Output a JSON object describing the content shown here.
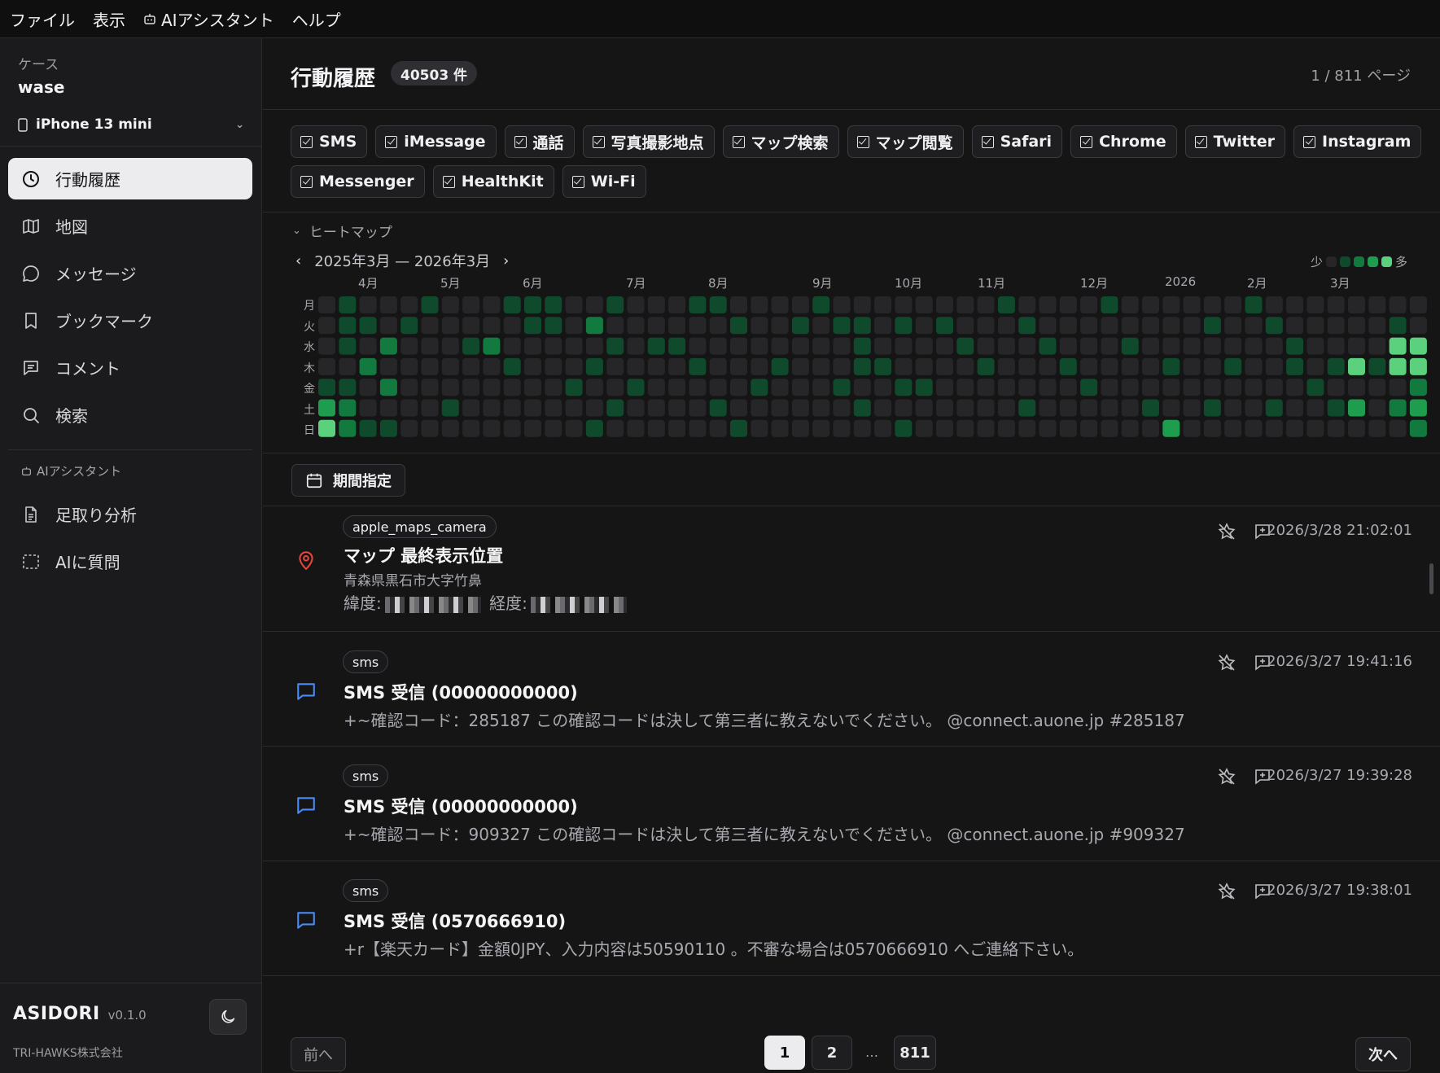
{
  "menu": [
    "ファイル",
    "表示",
    "AIアシスタント",
    "ヘルプ"
  ],
  "sidebar": {
    "case_label": "ケース",
    "case_name": "wase",
    "device": "iPhone 13 mini",
    "items": [
      {
        "label": "行動履歴",
        "icon": "clock-icon",
        "active": true
      },
      {
        "label": "地図",
        "icon": "map-icon"
      },
      {
        "label": "メッセージ",
        "icon": "message-icon"
      },
      {
        "label": "ブックマーク",
        "icon": "bookmark-icon"
      },
      {
        "label": "コメント",
        "icon": "comment-icon"
      },
      {
        "label": "検索",
        "icon": "search-icon"
      }
    ],
    "ai_header": "AIアシスタント",
    "ai_items": [
      {
        "label": "足取り分析",
        "icon": "document-icon"
      },
      {
        "label": "AIに質問",
        "icon": "dashed-square-icon"
      }
    ],
    "app_name": "ASIDORI",
    "version": "v0.1.0",
    "company": "TRI-HAWKS株式会社"
  },
  "header": {
    "title": "行動履歴",
    "count": "40503 件",
    "page_info": "1 / 811 ページ"
  },
  "filters": [
    "SMS",
    "iMessage",
    "通話",
    "写真撮影地点",
    "マップ検索",
    "マップ閲覧",
    "Safari",
    "Chrome",
    "Twitter",
    "Instagram",
    "Messenger",
    "HealthKit",
    "Wi-Fi"
  ],
  "heatmap": {
    "toggle_label": "ヒートマップ",
    "range": "2025年3月 — 2026年3月",
    "legend_less": "少",
    "legend_more": "多",
    "months": [
      "4月",
      "5月",
      "6月",
      "7月",
      "8月",
      "9月",
      "10月",
      "11月",
      "12月",
      "2026",
      "2月",
      "3月"
    ],
    "days": [
      "月",
      "火",
      "水",
      "木",
      "金",
      "土",
      "日"
    ],
    "colors": [
      "#262628",
      "#0f4a2c",
      "#137a3f",
      "#1f9d4f",
      "#5bd17d"
    ],
    "weeks": 53,
    "cells": [
      [
        4,
        0,
        1
      ],
      [
        5,
        0,
        3
      ],
      [
        6,
        0,
        4
      ],
      [
        0,
        1,
        1
      ],
      [
        1,
        1,
        1
      ],
      [
        2,
        1,
        1
      ],
      [
        4,
        1,
        1
      ],
      [
        5,
        1,
        2
      ],
      [
        6,
        1,
        2
      ],
      [
        1,
        2,
        1
      ],
      [
        3,
        2,
        2
      ],
      [
        6,
        2,
        1
      ],
      [
        2,
        3,
        2
      ],
      [
        4,
        3,
        2
      ],
      [
        6,
        3,
        1
      ],
      [
        1,
        4,
        1
      ],
      [
        0,
        5,
        1
      ],
      [
        5,
        6,
        1
      ],
      [
        2,
        7,
        1
      ],
      [
        2,
        8,
        2
      ],
      [
        0,
        9,
        1
      ],
      [
        3,
        9,
        1
      ],
      [
        0,
        10,
        1
      ],
      [
        1,
        10,
        1
      ],
      [
        0,
        11,
        1
      ],
      [
        1,
        11,
        1
      ],
      [
        4,
        12,
        1
      ],
      [
        1,
        13,
        2
      ],
      [
        3,
        13,
        1
      ],
      [
        6,
        13,
        1
      ],
      [
        0,
        14,
        1
      ],
      [
        2,
        14,
        1
      ],
      [
        5,
        14,
        1
      ],
      [
        4,
        15,
        1
      ],
      [
        2,
        16,
        1
      ],
      [
        2,
        17,
        1
      ],
      [
        0,
        18,
        1
      ],
      [
        3,
        18,
        1
      ],
      [
        0,
        19,
        1
      ],
      [
        5,
        19,
        1
      ],
      [
        1,
        20,
        1
      ],
      [
        6,
        20,
        1
      ],
      [
        4,
        21,
        1
      ],
      [
        3,
        22,
        1
      ],
      [
        1,
        23,
        1
      ],
      [
        0,
        24,
        1
      ],
      [
        1,
        25,
        1
      ],
      [
        4,
        25,
        1
      ],
      [
        1,
        26,
        1
      ],
      [
        2,
        26,
        1
      ],
      [
        3,
        26,
        1
      ],
      [
        5,
        26,
        1
      ],
      [
        3,
        27,
        1
      ],
      [
        1,
        28,
        1
      ],
      [
        4,
        28,
        1
      ],
      [
        6,
        28,
        1
      ],
      [
        4,
        29,
        1
      ],
      [
        1,
        30,
        1
      ],
      [
        2,
        31,
        1
      ],
      [
        3,
        32,
        1
      ],
      [
        0,
        33,
        1
      ],
      [
        1,
        34,
        1
      ],
      [
        5,
        34,
        1
      ],
      [
        2,
        35,
        1
      ],
      [
        3,
        36,
        1
      ],
      [
        4,
        37,
        1
      ],
      [
        0,
        38,
        1
      ],
      [
        2,
        39,
        1
      ],
      [
        5,
        40,
        1
      ],
      [
        6,
        41,
        3
      ],
      [
        3,
        41,
        1
      ],
      [
        1,
        43,
        1
      ],
      [
        5,
        43,
        1
      ],
      [
        3,
        44,
        1
      ],
      [
        0,
        45,
        1
      ],
      [
        1,
        46,
        1
      ],
      [
        5,
        46,
        1
      ],
      [
        2,
        47,
        1
      ],
      [
        3,
        47,
        1
      ],
      [
        4,
        48,
        1
      ],
      [
        3,
        49,
        1
      ],
      [
        5,
        49,
        1
      ],
      [
        3,
        50,
        4
      ],
      [
        5,
        50,
        3
      ],
      [
        3,
        51,
        1
      ],
      [
        1,
        52,
        1
      ],
      [
        2,
        52,
        4
      ],
      [
        3,
        52,
        4
      ],
      [
        5,
        52,
        2
      ],
      [
        2,
        53,
        4
      ],
      [
        3,
        53,
        4
      ],
      [
        4,
        53,
        2
      ],
      [
        5,
        53,
        3
      ],
      [
        6,
        53,
        2
      ]
    ]
  },
  "date_button": "期間指定",
  "entries": [
    {
      "tag": "apple_maps_camera",
      "icon": "map-pin-icon",
      "title": "マップ 最終表示位置",
      "subtitle": "青森県黒石市大字竹鼻",
      "lat_label": "緯度:",
      "lon_label": "経度:",
      "time": "2026/3/28 21:02:01"
    },
    {
      "tag": "sms",
      "icon": "chat-bubble-icon",
      "title": "SMS 受信 (00000000000)",
      "body": "+~確認コード：285187 この確認コードは決して第三者に教えないでください。 @connect.auone.jp #285187",
      "time": "2026/3/27 19:41:16"
    },
    {
      "tag": "sms",
      "icon": "chat-bubble-icon",
      "title": "SMS 受信 (00000000000)",
      "body": "+~確認コード：909327 この確認コードは決して第三者に教えないでください。 @connect.auone.jp #909327",
      "time": "2026/3/27 19:39:28"
    },
    {
      "tag": "sms",
      "icon": "chat-bubble-icon",
      "title": "SMS 受信 (0570666910)",
      "body": "+r【楽天カード】金額0JPY、入力内容は50590110 。不審な場合は0570666910 へご連絡下さい。",
      "time": "2026/3/27 19:38:01"
    }
  ],
  "pagination": {
    "prev": "前へ",
    "next": "次へ",
    "pages": [
      "1",
      "2",
      "…",
      "811"
    ],
    "current": "1"
  }
}
